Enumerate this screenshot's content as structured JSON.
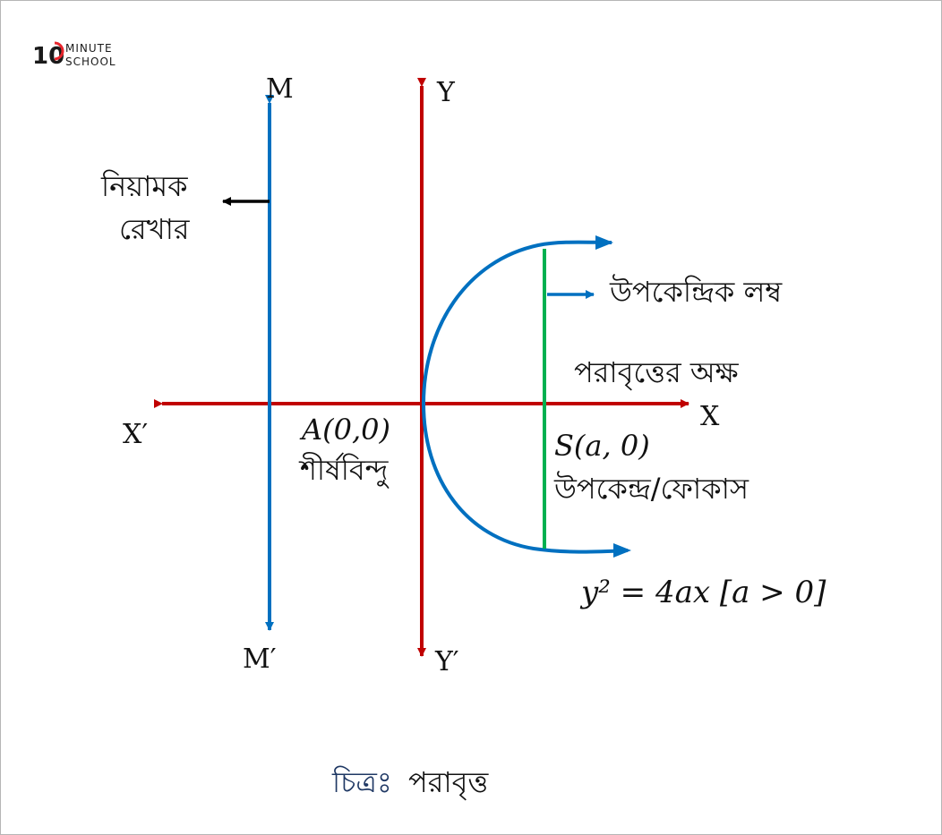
{
  "logo": {
    "number": "10",
    "line1": "MINUTE",
    "line2": "SCHOOL",
    "accent_color": "#e8262d"
  },
  "labels": {
    "directrix_top": "M",
    "directrix_bottom": "M′",
    "y_top": "Y",
    "y_bottom": "Y′",
    "x_left": "X′",
    "x_right": "X",
    "directrix_line1": "নিয়ামক",
    "directrix_line2": "রেখার",
    "latus_rectum": "উপকেন্দ্রিক লম্ব",
    "axis_of_parabola": "পরাবৃত্তের অক্ষ",
    "vertex_coord": "A(0,0)",
    "vertex_name": "শীর্ষবিন্দু",
    "focus_coord": "S(a, 0)",
    "focus_name": "উপকেন্দ্র/ফোকাস",
    "equation": "y² = 4ax [a > 0]",
    "caption_prefix": "চিত্রঃ",
    "caption_text": "পরাবৃত্ত"
  },
  "icons": {
    "arrow": "arrow-icon",
    "arrowhead": "arrowhead-icon"
  },
  "colors": {
    "axes": "#c00000",
    "directrix": "#0070c0",
    "parabola": "#0070c0",
    "latus_rectum": "#00b050",
    "pointer": "#000000",
    "caption_prefix": "#1f3864",
    "text": "#111111"
  }
}
